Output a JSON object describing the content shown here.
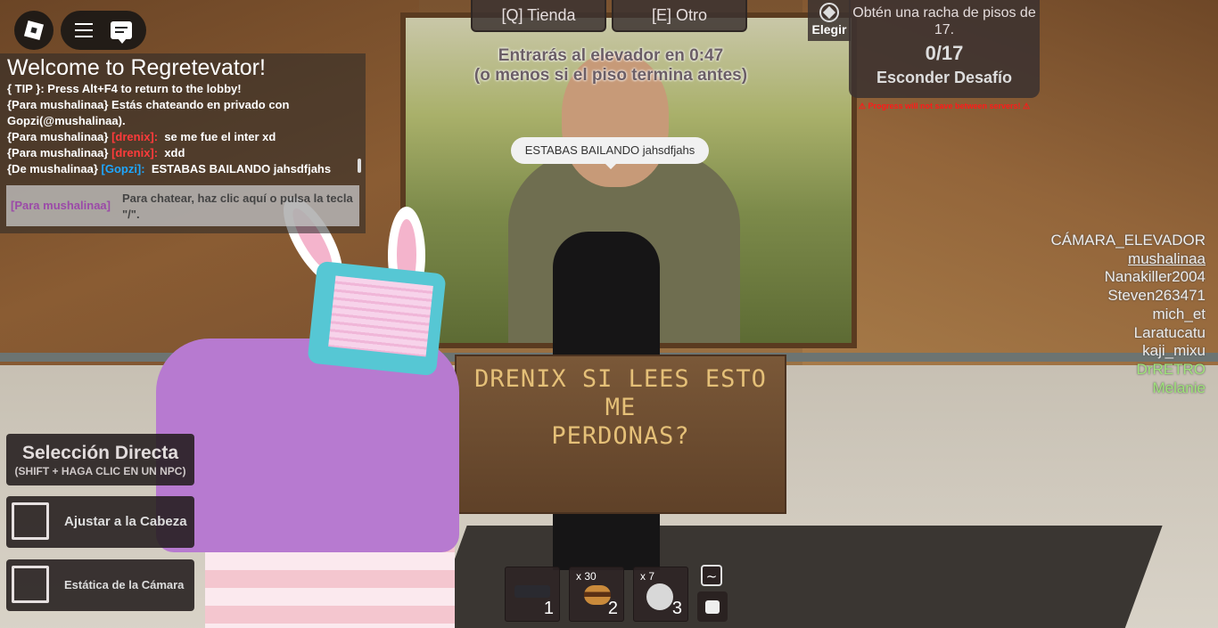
{
  "chat": {
    "title": "Welcome to Regretevator!",
    "lines": [
      {
        "prefix": "{ TIP }: Press Alt+F4 to return to the lobby!",
        "name": "",
        "msg": ""
      },
      {
        "prefix": "{Para mushalinaa} Estás chateando en privado con Gopzi(@mushalinaa).",
        "name": "",
        "msg": ""
      },
      {
        "prefix": "{Para mushalinaa}",
        "name": "[drenix]:",
        "msg": "se me fue el inter xd"
      },
      {
        "prefix": "{Para mushalinaa}",
        "name": "[drenix]:",
        "msg": "xdd"
      },
      {
        "prefix": "{De mushalinaa}",
        "name": "[Gopzi]:",
        "msg": "ESTABAS BAILANDO jahsdfjahs"
      }
    ],
    "input_target": "[Para mushalinaa]",
    "input_placeholder": "Para chatear, haz clic aquí o pulsa la tecla \"/\"."
  },
  "tabs": {
    "shop": "[Q] Tienda",
    "other": "[E] Otro"
  },
  "elevator": {
    "line1": "Entrarás al elevador en 0:47",
    "line2": "(o menos si el piso termina antes)"
  },
  "elegir": "Elegir",
  "challenge": {
    "text": "Obtén una racha de pisos de 17.",
    "progress": "0/17",
    "hide": "Esconder Desafío",
    "warning": "⚠ Progress will not save between servers! ⚠"
  },
  "bubble": "ESTABAS BAILANDO jahsdfjahs",
  "sign": {
    "line1": "DRENIX SI LEES ESTO ME",
    "line2": "PERDONAS?"
  },
  "players": [
    {
      "name": "CÁMARA_ELEVADOR"
    },
    {
      "name": "mushalinaa"
    },
    {
      "name": "Nanakiller2004"
    },
    {
      "name": "Steven263471"
    },
    {
      "name": "mich_et"
    },
    {
      "name": "Laratucatu"
    },
    {
      "name": "kaji_mixu"
    },
    {
      "name": "DrRETRO"
    },
    {
      "name": "Melanie"
    }
  ],
  "panels": {
    "select_title": "Selección Directa",
    "select_sub": "(SHIFT + HAGA CLIC EN UN NPC)",
    "head_snap": "Ajustar a la Cabeza",
    "camera_static": "Estática de la Cámara"
  },
  "hotbar": [
    {
      "slot": "1",
      "count": ""
    },
    {
      "slot": "2",
      "count": "x 30"
    },
    {
      "slot": "3",
      "count": "x 7"
    }
  ],
  "tilde": "~"
}
